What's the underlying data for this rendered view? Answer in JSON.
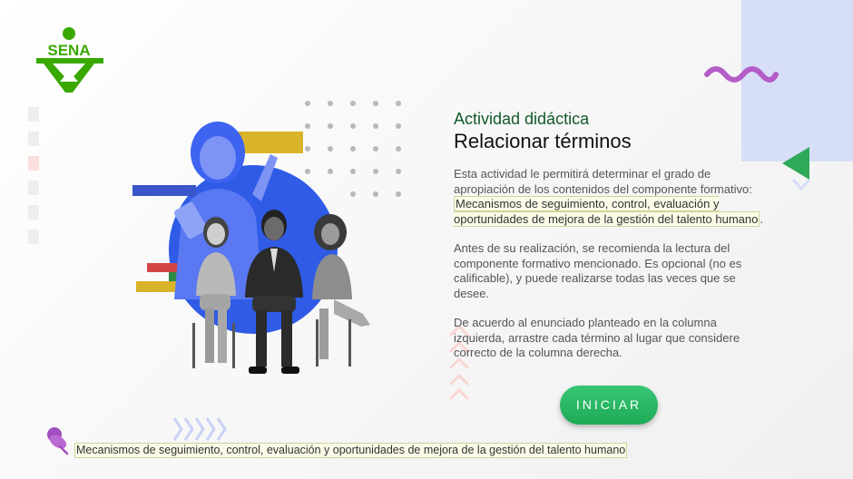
{
  "brand": {
    "logo_text": "SENA",
    "brand_color": "#39a900"
  },
  "header": {
    "subtitle": "Actividad didáctica",
    "title": "Relacionar términos"
  },
  "intro": {
    "text_before": "Esta actividad le permitirá determinar el grado de apropiación de los contenidos del componente formativo: ",
    "highlight": "Mecanismos de seguimiento, control, evaluación y oportunidades de mejora de la gestión del talento humano",
    "text_after": "."
  },
  "paragraph2": "Antes de su realización, se recomienda la lectura del componente formativo mencionado. Es opcional (no es calificable), y puede realizarse todas las veces que se desee.",
  "paragraph3": "De acuerdo al enunciado planteado en la columna izquierda, arrastre cada término al lugar que considere correcto de la columna derecha.",
  "start_button": {
    "label": "INICIAR"
  },
  "footer": {
    "icon": "pushpin-icon",
    "text": "Mecanismos de seguimiento, control, evaluación y oportunidades de mejora de la gestión del talento humano"
  },
  "colors": {
    "accent_green": "#1fa957",
    "title_green": "#13592b",
    "illustration_blue": "#2f5be6",
    "wave_purple": "#b45cc8",
    "triangle_green": "#2fa85a",
    "panel_blue": "#d6def8"
  }
}
